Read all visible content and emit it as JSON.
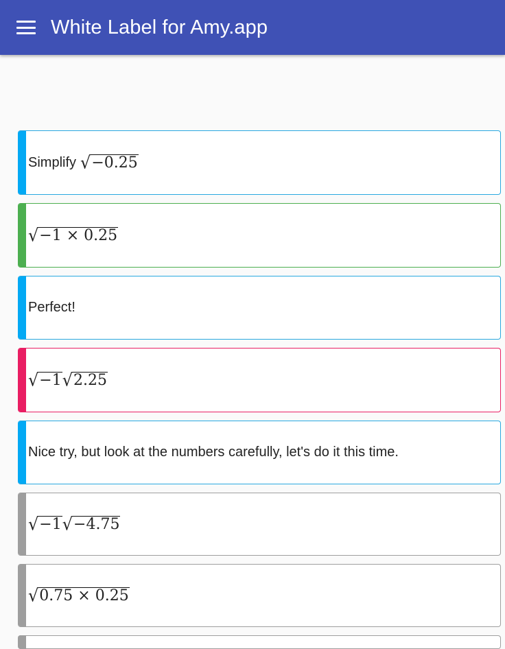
{
  "app_bar": {
    "title": "White Label for Amy.app",
    "menu_icon": "menu-icon",
    "color": "#3f51b5"
  },
  "colors": {
    "blue": "#03a9f4",
    "green": "#4caf50",
    "pink": "#e91e63",
    "gray": "#9e9e9e"
  },
  "messages": [
    {
      "type": "prompt",
      "color": "blue",
      "prefix": "Simplify",
      "radicand": "−0.25"
    },
    {
      "type": "answer",
      "color": "green",
      "radicand": "−1 × 0.25"
    },
    {
      "type": "feedback",
      "color": "blue",
      "text": "Perfect!"
    },
    {
      "type": "answer",
      "color": "pink",
      "radicands": [
        "−1",
        "2.25"
      ]
    },
    {
      "type": "feedback",
      "color": "blue",
      "text": "Nice try, but look at the numbers carefully, let's do it this time."
    },
    {
      "type": "option",
      "color": "gray",
      "radicands": [
        "−1",
        "−4.75"
      ]
    },
    {
      "type": "option",
      "color": "gray",
      "radicand": "0.75 × 0.25"
    }
  ]
}
